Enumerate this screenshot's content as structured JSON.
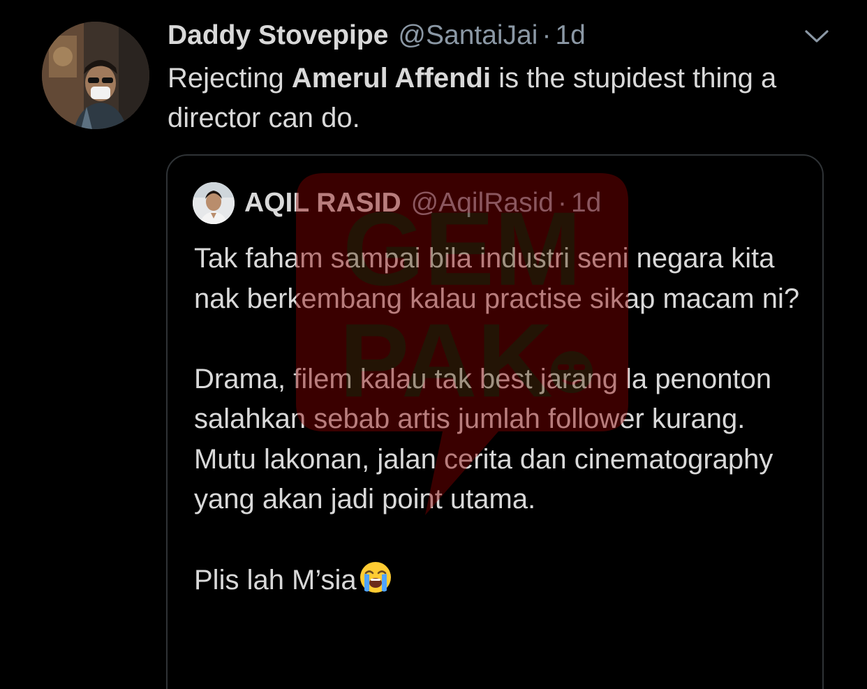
{
  "tweet": {
    "display_name": "Daddy Stovepipe",
    "handle": "@SantaiJai",
    "separator": "·",
    "time": "1d",
    "text_before": "Rejecting ",
    "text_bold": "Amerul Affendi",
    "text_after": " is the stupidest thing a director can do.",
    "more_icon": "chevron-down-icon"
  },
  "quote": {
    "display_name": "AQIL RASID",
    "handle": "@AqilRasid",
    "separator": "·",
    "time": "1d",
    "paragraph_1": "Tak faham sampai bila industri seni negara kita nak berkembang kalau practise sikap macam ni?",
    "paragraph_2": "Drama, filem kalau tak best jarang la penonton salahkan sebab artis jumlah follower kurang. Mutu lakonan, jalan cerita dan cinematography yang akan jadi point utama.",
    "paragraph_3": "Plis lah M’sia",
    "emoji": "loudly-crying-face-emoji"
  },
  "watermark": {
    "line_1": "GEM",
    "line_2": "PAK",
    "color": "#8b0000"
  },
  "colors": {
    "background": "#000000",
    "primary_text": "#d9d9d9",
    "secondary_text": "#8b98a5",
    "border": "#2f3336"
  }
}
